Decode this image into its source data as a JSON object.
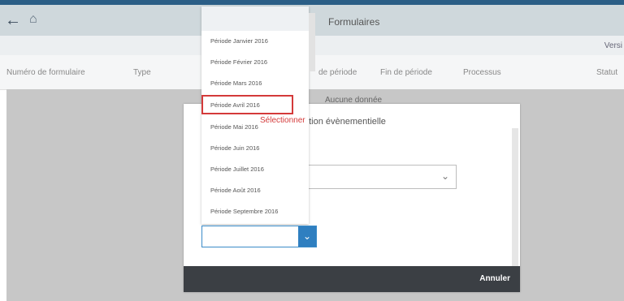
{
  "header": {
    "title": "Formulaires",
    "back_icon": "back-arrow-icon",
    "home_icon": "home-icon"
  },
  "subheader": {
    "version_label": "Versi"
  },
  "columns": [
    "Numéro de formulaire",
    "Type",
    "de période",
    "Fin de période",
    "Processus",
    "Statut"
  ],
  "behind_text": "Aucune donnée",
  "modal": {
    "title": "ation évènementielle",
    "label": ":",
    "cancel_label": "Annuler"
  },
  "dropdown": {
    "items": [
      "Période Janvier 2016",
      "Période Février 2016",
      "Période Mars 2016",
      "Période Avril 2016",
      "Période Mai 2016",
      "Période Juin 2016",
      "Période Juillet 2016",
      "Période Août 2016",
      "Période Septembre 2016"
    ],
    "selected_index": 3
  },
  "annotation": "Sélectionner",
  "colors": {
    "header_bg": "#cfd8dc",
    "accent": "#2f7fc0",
    "highlight": "#d43a3a",
    "footer_bg": "#3b3f44"
  }
}
